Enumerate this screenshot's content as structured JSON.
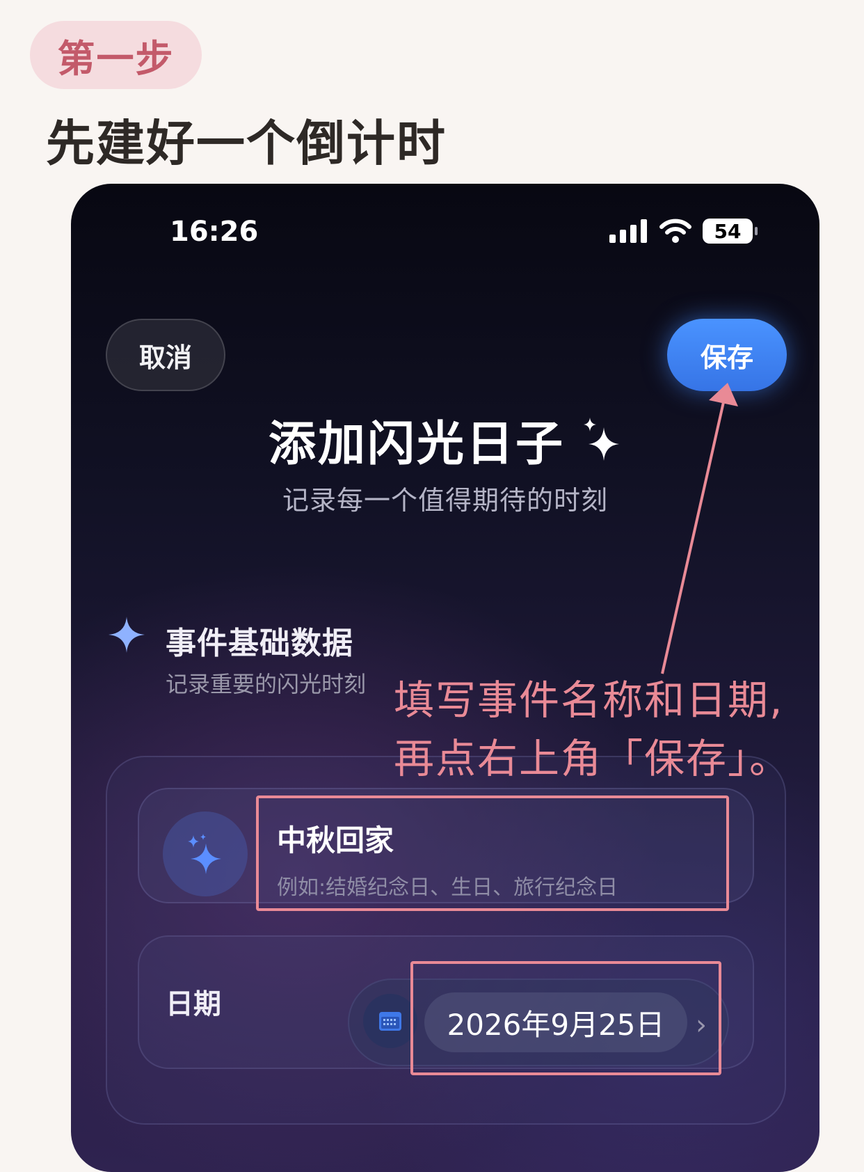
{
  "guide": {
    "step": "第一步",
    "heading": "先建好一个倒计时",
    "annotation_line1": "填写事件名称和日期,",
    "annotation_line2": "再点右上角「保存」。"
  },
  "phone": {
    "status_bar": {
      "time": "16:26",
      "battery": "54",
      "icons": [
        "signal-icon",
        "wifi-icon",
        "battery-icon"
      ]
    },
    "nav": {
      "cancel_label": "取消",
      "save_label": "保存"
    },
    "header": {
      "title": "添加闪光日子",
      "subtitle": "记录每一个值得期待的时刻"
    },
    "section": {
      "title": "事件基础数据",
      "subtitle": "记录重要的闪光时刻"
    },
    "form": {
      "name_value": "中秋回家",
      "name_placeholder": "例如:结婚纪念日、生日、旅行纪念日",
      "date_label": "日期",
      "date_value": "2026年9月25日"
    }
  },
  "colors": {
    "save_button": "#3a7cf0",
    "annotation": "#e98a96",
    "step_badge_bg": "#f5dcdf",
    "step_badge_text": "#c35a6a"
  }
}
